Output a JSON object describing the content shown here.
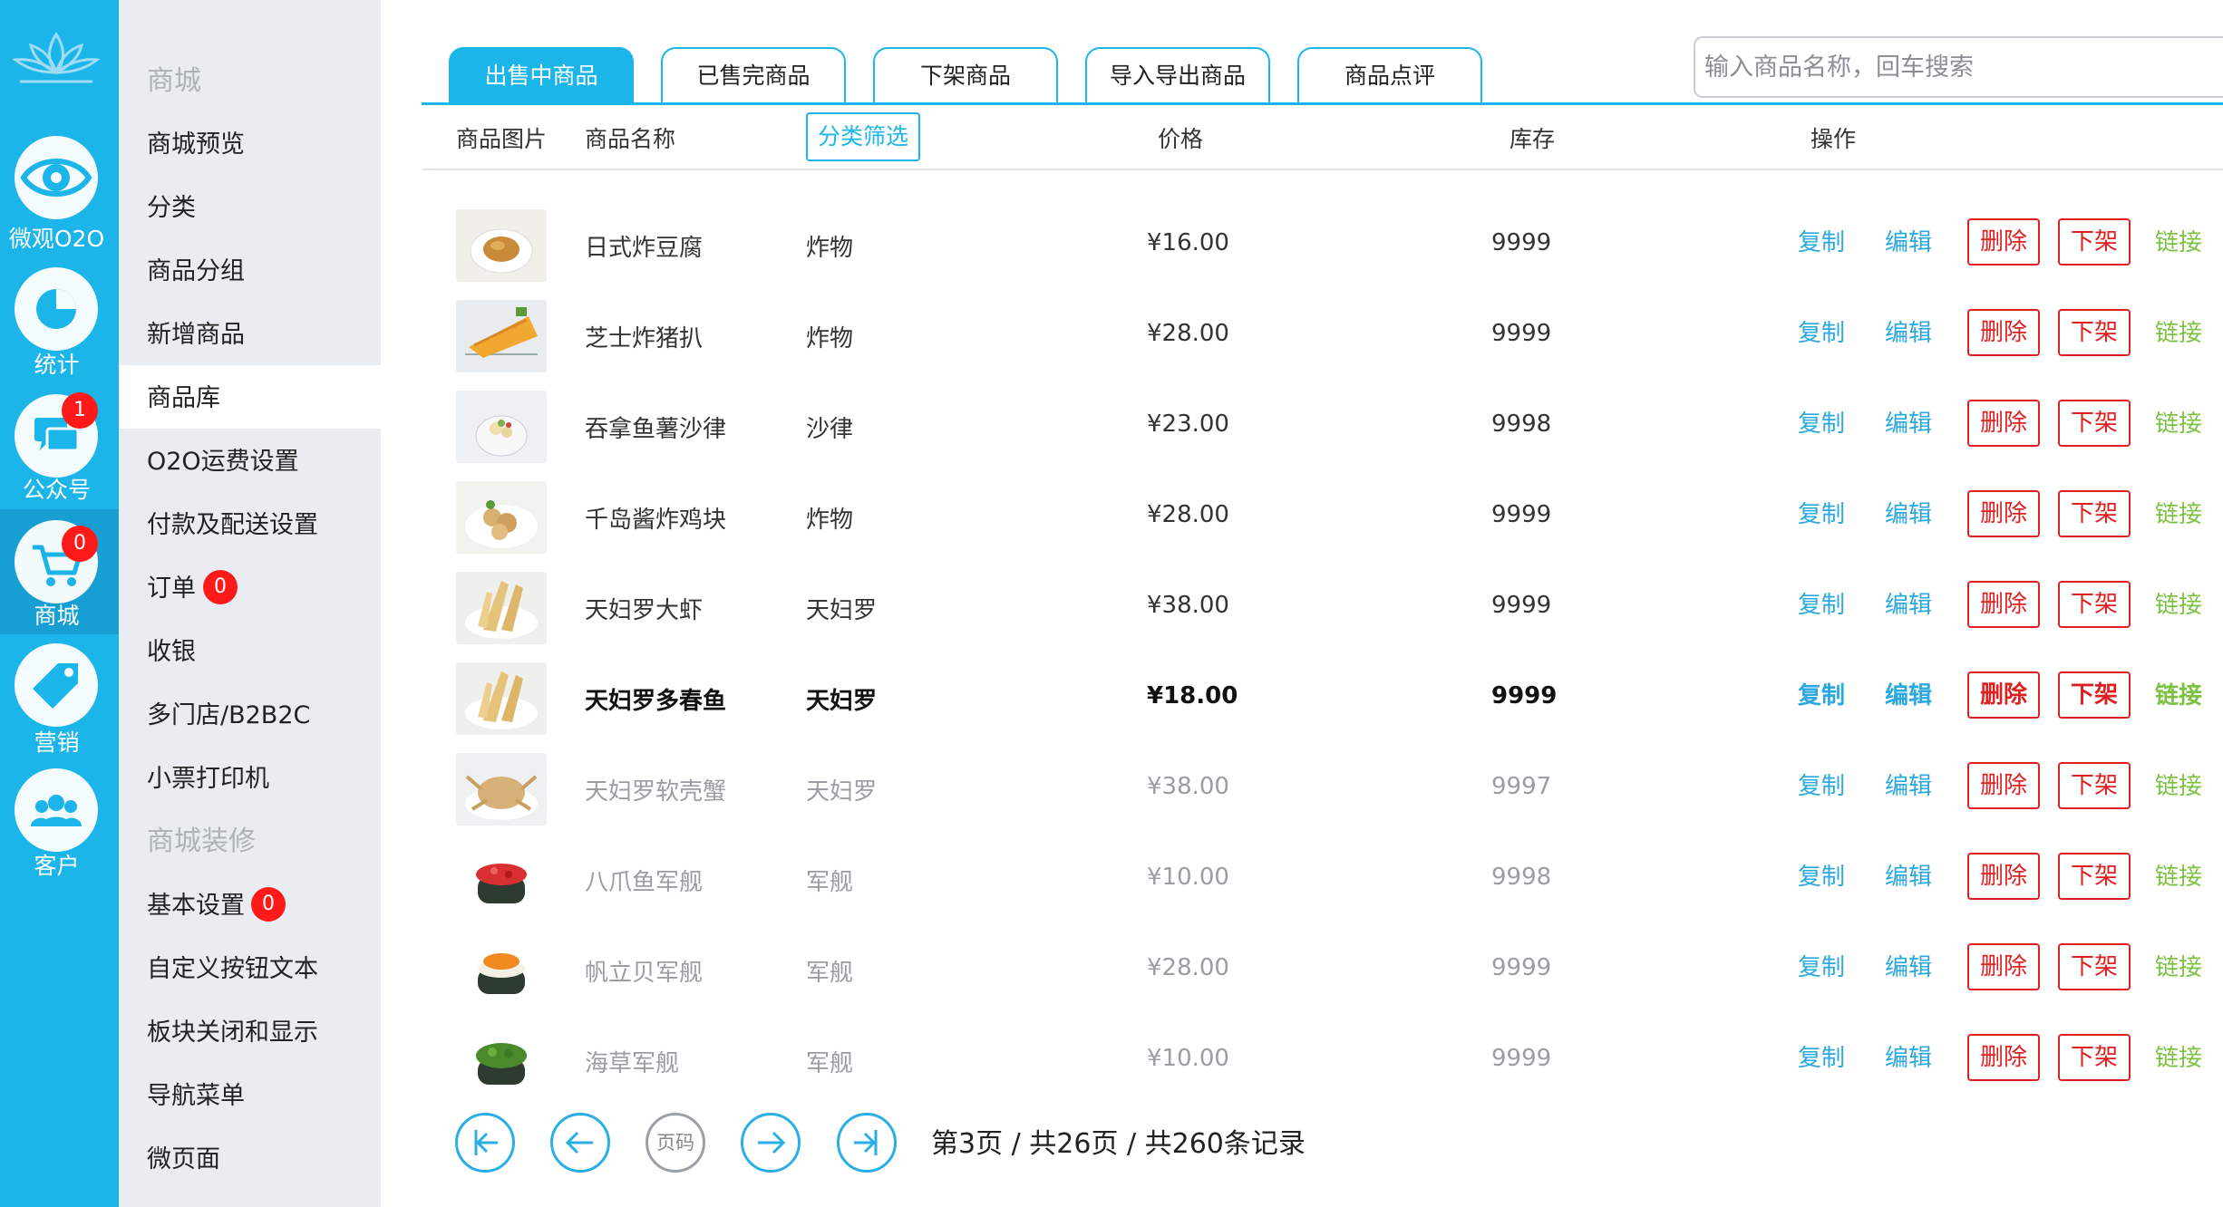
{
  "rail": {
    "items": [
      {
        "label": "微观O2O",
        "icon": "eye-icon"
      },
      {
        "label": "统计",
        "icon": "pie-chart-icon"
      },
      {
        "label": "公众号",
        "icon": "chat-bubbles-icon",
        "badge": "1"
      },
      {
        "label": "商城",
        "icon": "cart-icon",
        "badge": "0"
      },
      {
        "label": "营销",
        "icon": "tag-icon"
      },
      {
        "label": "客户",
        "icon": "users-icon"
      }
    ]
  },
  "menu": {
    "items": [
      {
        "label": "商城",
        "type": "section"
      },
      {
        "label": "商城预览"
      },
      {
        "label": "分类"
      },
      {
        "label": "商品分组"
      },
      {
        "label": "新增商品"
      },
      {
        "label": "商品库",
        "active": true
      },
      {
        "label": "O2O运费设置"
      },
      {
        "label": "付款及配送设置"
      },
      {
        "label": "订单",
        "badge": "0"
      },
      {
        "label": "收银"
      },
      {
        "label": "多门店/B2B2C"
      },
      {
        "label": "小票打印机"
      },
      {
        "label": "商城装修",
        "type": "section"
      },
      {
        "label": "基本设置",
        "badge": "0"
      },
      {
        "label": "自定义按钮文本"
      },
      {
        "label": "板块关闭和显示"
      },
      {
        "label": "导航菜单"
      },
      {
        "label": "微页面"
      }
    ]
  },
  "tabs": [
    "出售中商品",
    "已售完商品",
    "下架商品",
    "导入导出商品",
    "商品点评"
  ],
  "search": {
    "placeholder": "输入商品名称，回车搜索"
  },
  "table": {
    "headers": {
      "image": "商品图片",
      "name": "商品名称",
      "filter": "分类筛选",
      "price": "价格",
      "stock": "库存",
      "actions": "操作"
    },
    "actions": {
      "copy": "复制",
      "edit": "编辑",
      "delete": "删除",
      "offshelf": "下架",
      "link": "链接"
    },
    "rows": [
      {
        "name": "日式炸豆腐",
        "category": "炸物",
        "price": "¥16.00",
        "stock": "9999",
        "img": "tofu"
      },
      {
        "name": "芝士炸猪扒",
        "category": "炸物",
        "price": "¥28.00",
        "stock": "9999",
        "img": "cutlet"
      },
      {
        "name": "吞拿鱼薯沙律",
        "category": "沙律",
        "price": "¥23.00",
        "stock": "9998",
        "img": "salad"
      },
      {
        "name": "千岛酱炸鸡块",
        "category": "炸物",
        "price": "¥28.00",
        "stock": "9999",
        "img": "chicken"
      },
      {
        "name": "天妇罗大虾",
        "category": "天妇罗",
        "price": "¥38.00",
        "stock": "9999",
        "img": "tempura"
      },
      {
        "name": "天妇罗多春鱼",
        "category": "天妇罗",
        "price": "¥18.00",
        "stock": "9999",
        "img": "tempura",
        "style": "bold"
      },
      {
        "name": "天妇罗软壳蟹",
        "category": "天妇罗",
        "price": "¥38.00",
        "stock": "9997",
        "img": "crab",
        "style": "light"
      },
      {
        "name": "八爪鱼军舰",
        "category": "军舰",
        "price": "¥10.00",
        "stock": "9998",
        "img": "sushi-red",
        "style": "light"
      },
      {
        "name": "帆立贝军舰",
        "category": "军舰",
        "price": "¥28.00",
        "stock": "9999",
        "img": "sushi-orange",
        "style": "light"
      },
      {
        "name": "海草军舰",
        "category": "军舰",
        "price": "¥10.00",
        "stock": "9999",
        "img": "sushi-green",
        "style": "light"
      }
    ]
  },
  "pager": {
    "page_input": "页码",
    "info": "第3页 / 共26页 / 共260条记录"
  },
  "colors": {
    "primary": "#1cb5ea",
    "danger": "#e02020",
    "link": "#7cc142",
    "badge": "#ff1a1a"
  }
}
